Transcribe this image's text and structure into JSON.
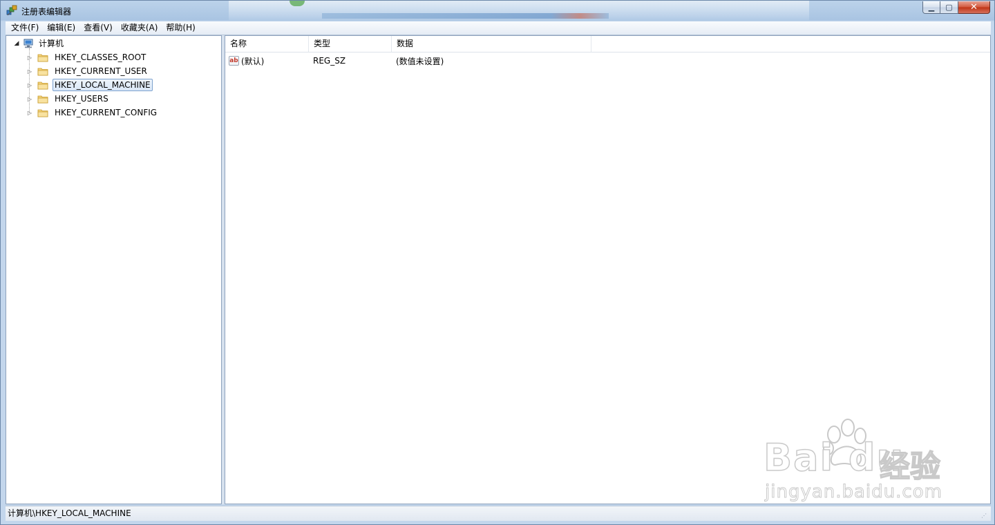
{
  "window": {
    "title": "注册表编辑器",
    "controls": {
      "minimize": "▁",
      "maximize": "▢",
      "close": "✕"
    }
  },
  "menu": [
    {
      "label": "文件(F)"
    },
    {
      "label": "编辑(E)"
    },
    {
      "label": "查看(V)"
    },
    {
      "label": "收藏夹(A)"
    },
    {
      "label": "帮助(H)"
    }
  ],
  "tree": {
    "root": {
      "label": "计算机",
      "expanded": true
    },
    "keys": [
      {
        "label": "HKEY_CLASSES_ROOT",
        "selected": false
      },
      {
        "label": "HKEY_CURRENT_USER",
        "selected": false
      },
      {
        "label": "HKEY_LOCAL_MACHINE",
        "selected": true
      },
      {
        "label": "HKEY_USERS",
        "selected": false
      },
      {
        "label": "HKEY_CURRENT_CONFIG",
        "selected": false
      }
    ]
  },
  "list": {
    "columns": [
      "名称",
      "类型",
      "数据"
    ],
    "rows": [
      {
        "icon": "ab-string-value-icon",
        "name": "(默认)",
        "type": "REG_SZ",
        "data": "(数值未设置)"
      }
    ]
  },
  "status": {
    "path": "计算机\\HKEY_LOCAL_MACHINE"
  },
  "watermark": {
    "brand": "Bai du",
    "cn": "经验",
    "url": "jingyan.baidu.com"
  },
  "colors": {
    "selection_border": "#7da2ce",
    "window_frame": "#a9c4e2",
    "close_button": "#c03414"
  }
}
